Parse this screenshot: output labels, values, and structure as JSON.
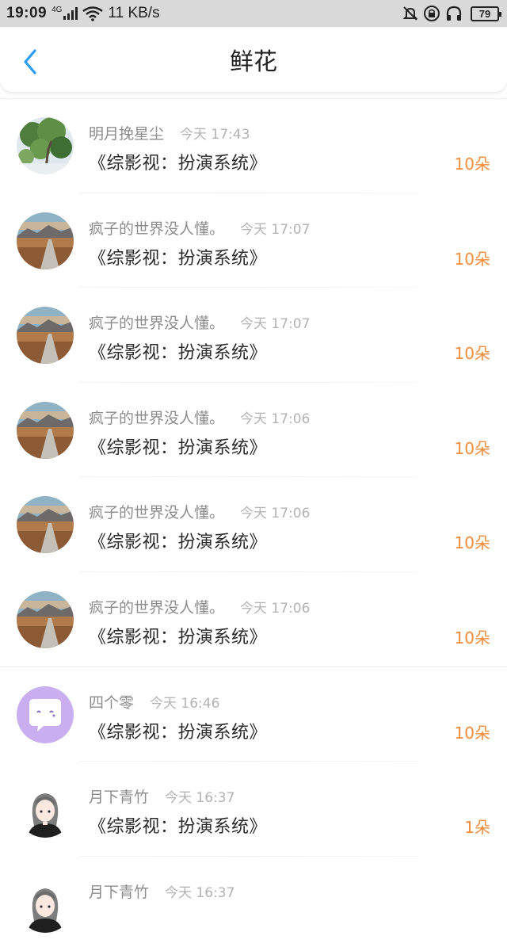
{
  "status_bar": {
    "time": "19:09",
    "network": "4G",
    "speed": "11 KB/s",
    "battery": "79"
  },
  "header": {
    "title": "鲜花"
  },
  "colors": {
    "accent": "#2a9df4",
    "count": "#f28c38"
  },
  "items": [
    {
      "name": "明月挽星尘",
      "time": "今天 17:43",
      "book": "《综影视：扮演系统》",
      "count": "10朵",
      "avatar": "tree-photo"
    },
    {
      "name": "疯子的世界没人懂。",
      "time": "今天 17:07",
      "book": "《综影视：扮演系统》",
      "count": "10朵",
      "avatar": "road-landscape"
    },
    {
      "name": "疯子的世界没人懂。",
      "time": "今天 17:07",
      "book": "《综影视：扮演系统》",
      "count": "10朵",
      "avatar": "road-landscape"
    },
    {
      "name": "疯子的世界没人懂。",
      "time": "今天 17:06",
      "book": "《综影视：扮演系统》",
      "count": "10朵",
      "avatar": "road-landscape"
    },
    {
      "name": "疯子的世界没人懂。",
      "time": "今天 17:06",
      "book": "《综影视：扮演系统》",
      "count": "10朵",
      "avatar": "road-landscape"
    },
    {
      "name": "疯子的世界没人懂。",
      "time": "今天 17:06",
      "book": "《综影视：扮演系统》",
      "count": "10朵",
      "avatar": "road-landscape"
    },
    {
      "name": "四个零",
      "time": "今天 16:46",
      "book": "《综影视：扮演系统》",
      "count": "10朵",
      "avatar": "chat-bubble"
    },
    {
      "name": "月下青竹",
      "time": "今天 16:37",
      "book": "《综影视：扮演系统》",
      "count": "1朵",
      "avatar": "anime-girl"
    },
    {
      "name": "月下青竹",
      "time": "今天 16:37",
      "book": "",
      "count": "",
      "avatar": "anime-girl"
    }
  ]
}
